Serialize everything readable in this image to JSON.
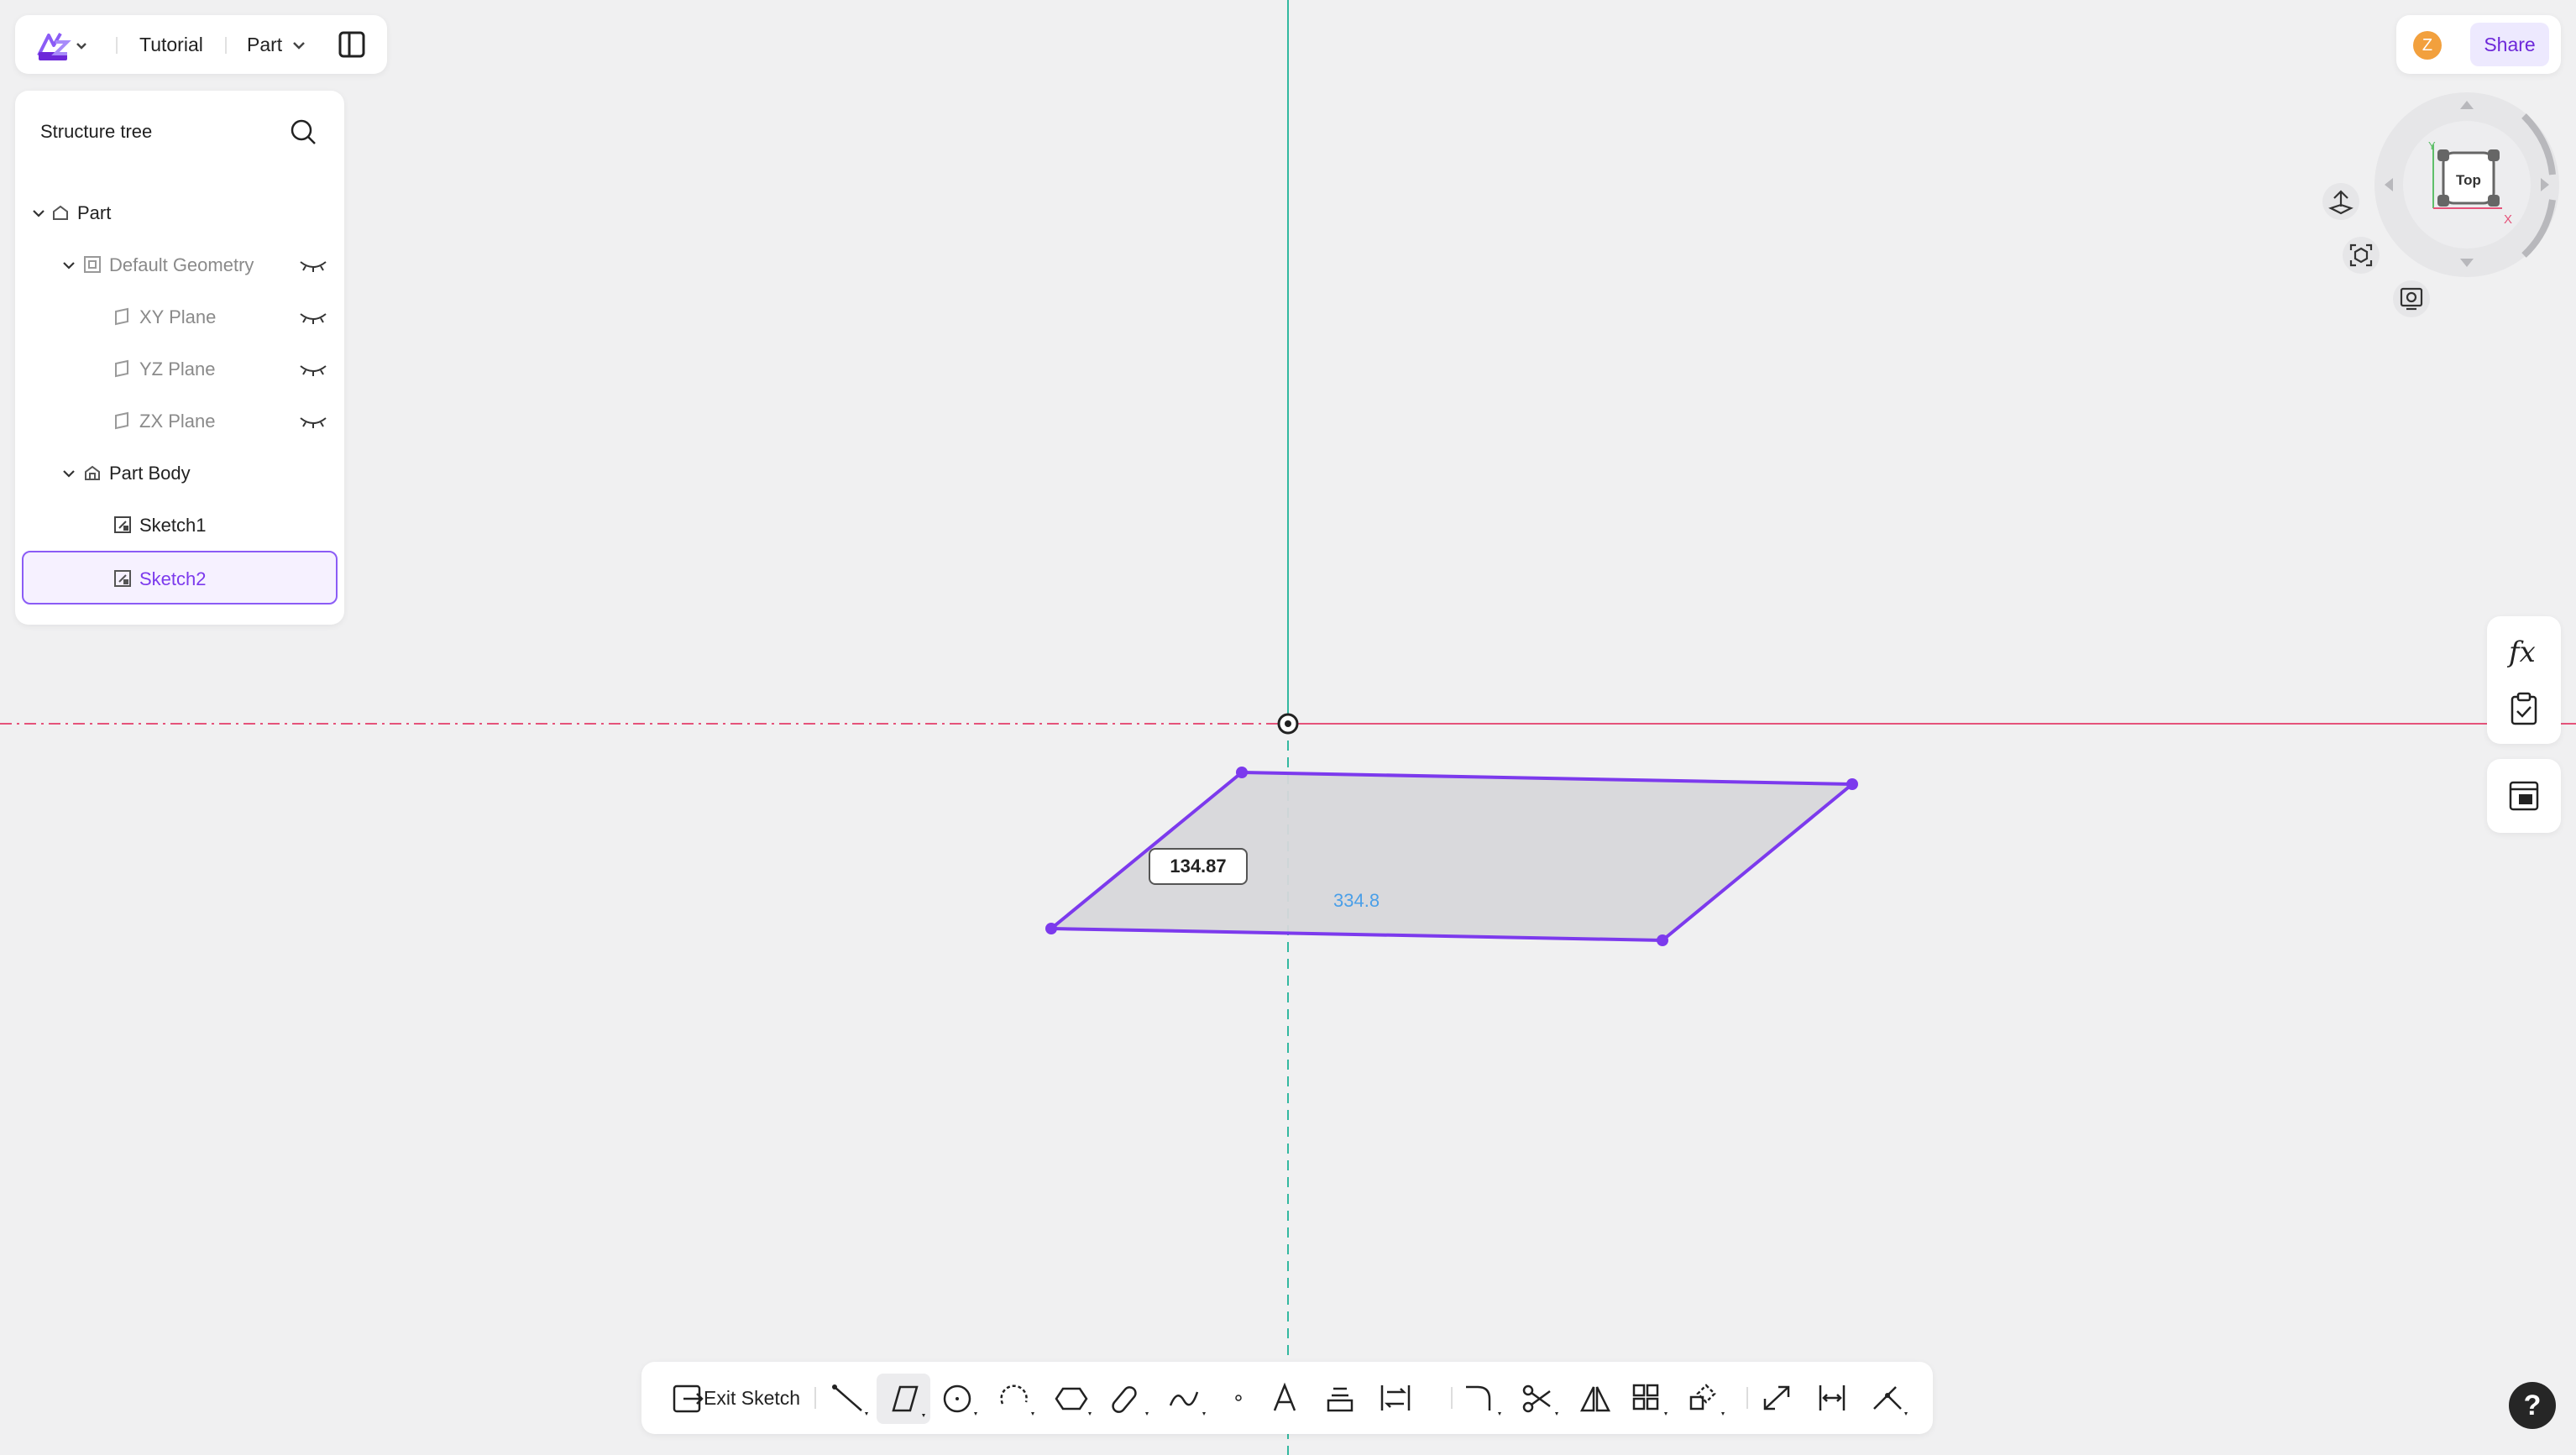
{
  "topbar": {
    "tutorial_label": "Tutorial",
    "part_label": "Part"
  },
  "structure_tree": {
    "title": "Structure tree",
    "items": [
      {
        "label": "Part"
      },
      {
        "label": "Default Geometry"
      },
      {
        "label": "XY Plane"
      },
      {
        "label": "YZ Plane"
      },
      {
        "label": "ZX Plane"
      },
      {
        "label": "Part Body"
      },
      {
        "label": "Sketch1"
      },
      {
        "label": "Sketch2"
      }
    ]
  },
  "header_right": {
    "avatar_initial": "Z",
    "share_label": "Share"
  },
  "view_cube": {
    "face_label": "Top",
    "axis_x": "X",
    "axis_y": "Y"
  },
  "canvas": {
    "dimension_input_value": "134.87",
    "dimension_preview_value": "334.8"
  },
  "toolbar": {
    "exit_sketch_label": "Exit Sketch"
  },
  "help": {
    "label": "?"
  },
  "colors": {
    "accent": "#7c3aed",
    "x_axis": "#e5537a",
    "y_axis": "#33b8a0",
    "sketch_fill": "#d7d7da"
  }
}
